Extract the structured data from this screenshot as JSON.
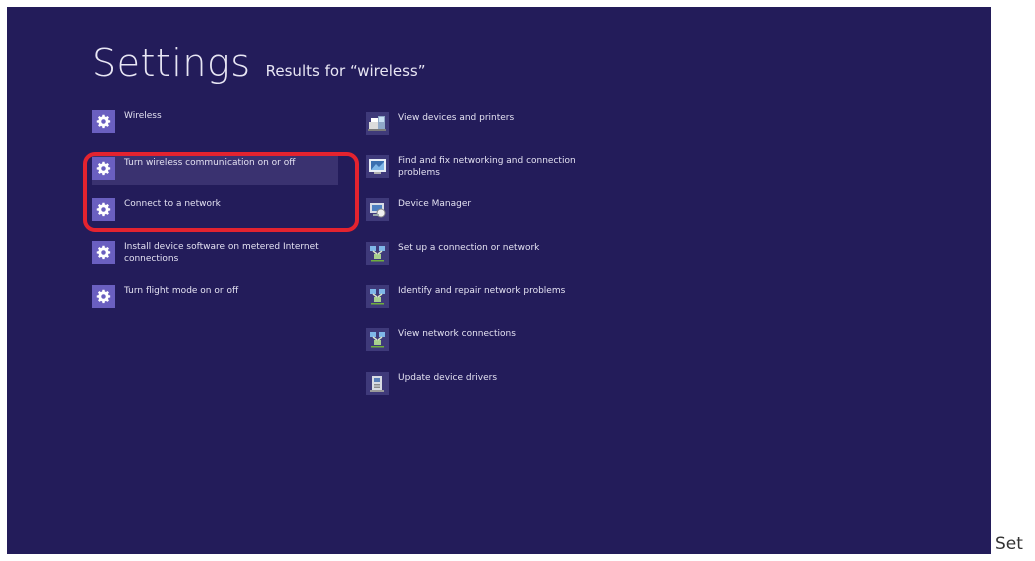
{
  "header": {
    "title": "Settings",
    "subtitle": "Results for “wireless”"
  },
  "settings_results": [
    {
      "label": "Wireless",
      "icon": "gear-icon"
    },
    {
      "label": "Turn wireless communication on or off",
      "icon": "gear-icon"
    },
    {
      "label": "Connect to a network",
      "icon": "gear-icon"
    },
    {
      "label": "Install device software on metered Internet connections",
      "icon": "gear-icon"
    },
    {
      "label": "Turn flight mode on or off",
      "icon": "gear-icon"
    }
  ],
  "control_panel_results": [
    {
      "label": "View devices and printers",
      "icon": "devices-printers-icon"
    },
    {
      "label": "Find and fix networking and connection problems",
      "icon": "troubleshoot-icon"
    },
    {
      "label": "Device Manager",
      "icon": "device-manager-icon"
    },
    {
      "label": "Set up a connection or network",
      "icon": "network-icon"
    },
    {
      "label": "Identify and repair network problems",
      "icon": "network-icon"
    },
    {
      "label": "View network connections",
      "icon": "network-icon"
    },
    {
      "label": "Update device drivers",
      "icon": "driver-update-icon"
    }
  ],
  "highlight": {
    "color": "#e4232f"
  },
  "caption": "Set",
  "colors": {
    "background": "#231c5a",
    "gear_tile": "#6a5fc0",
    "text": "#e4e2f2"
  }
}
